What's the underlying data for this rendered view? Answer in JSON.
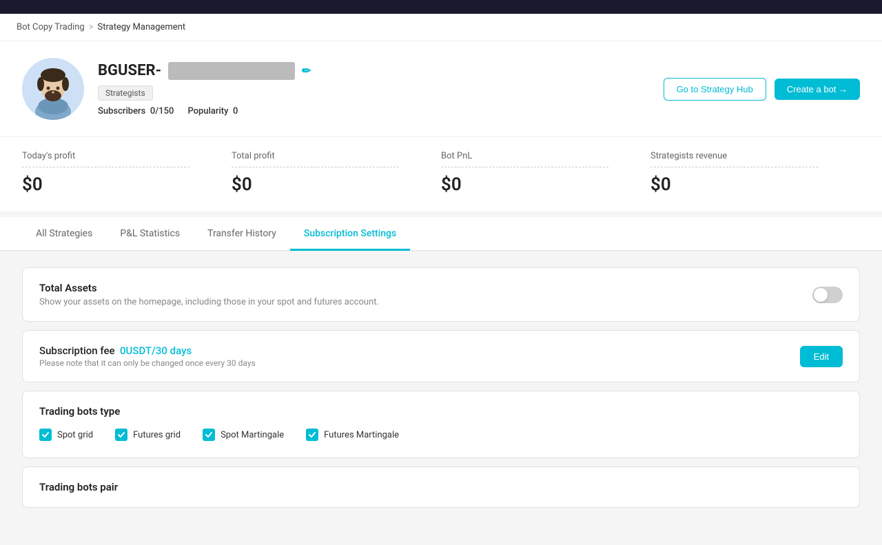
{
  "topbar": {},
  "breadcrumb": {
    "link": "Bot Copy Trading",
    "separator": ">",
    "current": "Strategy Management"
  },
  "profile": {
    "username_prefix": "BGUSER-",
    "username_masked": "██████████",
    "edit_icon": "✏",
    "badge": "Strategists",
    "subscribers_label": "Subscribers",
    "subscribers_value": "0",
    "subscribers_max": "/150",
    "popularity_label": "Popularity",
    "popularity_value": "0",
    "btn_strategy_hub": "Go to Strategy Hub",
    "btn_create_bot": "Create a bot →"
  },
  "stats": [
    {
      "label": "Today's profit",
      "value": "$0"
    },
    {
      "label": "Total profit",
      "value": "$0"
    },
    {
      "label": "Bot PnL",
      "value": "$0"
    },
    {
      "label": "Strategists revenue",
      "value": "$0"
    }
  ],
  "tabs": [
    {
      "label": "All Strategies",
      "active": false
    },
    {
      "label": "P&L Statistics",
      "active": false
    },
    {
      "label": "Transfer History",
      "active": false
    },
    {
      "label": "Subscription Settings",
      "active": true
    }
  ],
  "subscription_settings": {
    "total_assets": {
      "title": "Total Assets",
      "description": "Show your assets on the homepage, including those in your spot and futures account.",
      "toggle": "off"
    },
    "subscription_fee": {
      "title": "Subscription fee",
      "fee_value": "0USDT/30 days",
      "note": "Please note that it can only be changed once every 30 days",
      "btn_edit": "Edit"
    },
    "trading_bots_type": {
      "title": "Trading bots type",
      "checkboxes": [
        {
          "label": "Spot grid",
          "checked": true
        },
        {
          "label": "Futures grid",
          "checked": true
        },
        {
          "label": "Spot Martingale",
          "checked": true
        },
        {
          "label": "Futures Martingale",
          "checked": true
        }
      ]
    },
    "trading_bots_pair": {
      "title": "Trading bots pair"
    }
  }
}
